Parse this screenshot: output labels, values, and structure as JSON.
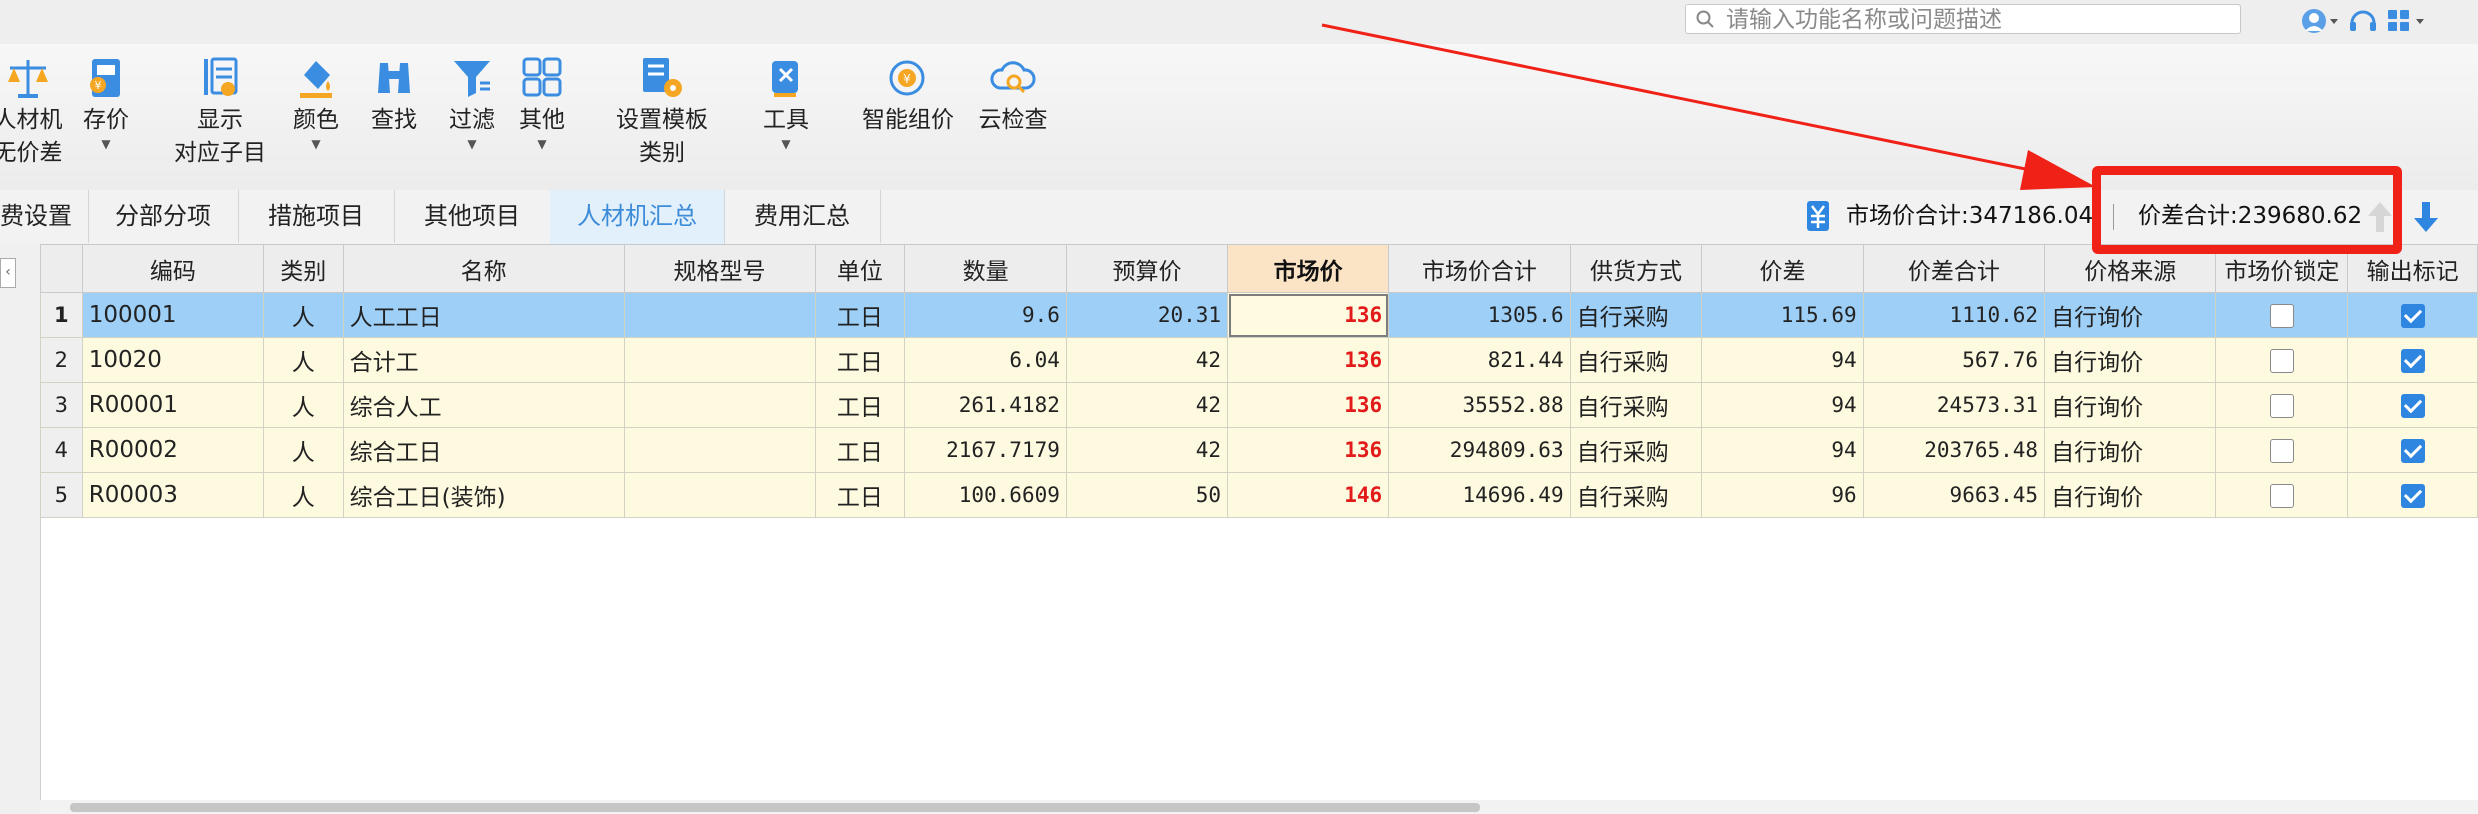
{
  "search": {
    "placeholder": "请输入功能名称或问题描述"
  },
  "ribbon": {
    "items": [
      {
        "label1": "人材机",
        "label2": "无价差",
        "icon": "scale-icon",
        "dropdown": false
      },
      {
        "label1": "存价",
        "label2": "",
        "icon": "save-price-icon",
        "dropdown": true
      },
      {
        "label1": "显示",
        "label2": "对应子目",
        "icon": "show-list-icon",
        "dropdown": false
      },
      {
        "label1": "颜色",
        "label2": "",
        "icon": "paint-bucket-icon",
        "dropdown": true
      },
      {
        "label1": "查找",
        "label2": "",
        "icon": "binoculars-icon",
        "dropdown": false
      },
      {
        "label1": "过滤",
        "label2": "",
        "icon": "filter-icon",
        "dropdown": true
      },
      {
        "label1": "其他",
        "label2": "",
        "icon": "grid-icon",
        "dropdown": true
      },
      {
        "label1": "设置模板",
        "label2": "类别",
        "icon": "template-settings-icon",
        "dropdown": false
      },
      {
        "label1": "工具",
        "label2": "",
        "icon": "tools-icon",
        "dropdown": true
      },
      {
        "label1": "智能组价",
        "label2": "",
        "icon": "smart-pricing-icon",
        "dropdown": false
      },
      {
        "label1": "云检查",
        "label2": "",
        "icon": "cloud-check-icon",
        "dropdown": false
      }
    ]
  },
  "tabs": [
    {
      "label": "费设置",
      "active": false
    },
    {
      "label": "分部分项",
      "active": false
    },
    {
      "label": "措施项目",
      "active": false
    },
    {
      "label": "其他项目",
      "active": false
    },
    {
      "label": "人材机汇总",
      "active": true
    },
    {
      "label": "费用汇总",
      "active": false
    }
  ],
  "summary": {
    "market_total_label": "市场价合计:347186.04",
    "diff_total_label": "价差合计:239680.62"
  },
  "table": {
    "headers": [
      "",
      "编码",
      "类别",
      "名称",
      "规格型号",
      "单位",
      "数量",
      "预算价",
      "市场价",
      "市场价合计",
      "供货方式",
      "价差",
      "价差合计",
      "价格来源",
      "市场价锁定",
      "输出标记"
    ],
    "rows": [
      {
        "no": "1",
        "code": "100001",
        "type": "人",
        "name": "人工工日",
        "spec": "",
        "unit": "工日",
        "qty": "9.6",
        "budget": "20.31",
        "market": "136",
        "market_total": "1305.6",
        "supply": "自行采购",
        "diff": "115.69",
        "diff_total": "1110.62",
        "source": "自行询价",
        "locked": false,
        "output": true
      },
      {
        "no": "2",
        "code": "10020",
        "type": "人",
        "name": "合计工",
        "spec": "",
        "unit": "工日",
        "qty": "6.04",
        "budget": "42",
        "market": "136",
        "market_total": "821.44",
        "supply": "自行采购",
        "diff": "94",
        "diff_total": "567.76",
        "source": "自行询价",
        "locked": false,
        "output": true
      },
      {
        "no": "3",
        "code": "R00001",
        "type": "人",
        "name": "综合人工",
        "spec": "",
        "unit": "工日",
        "qty": "261.4182",
        "budget": "42",
        "market": "136",
        "market_total": "35552.88",
        "supply": "自行采购",
        "diff": "94",
        "diff_total": "24573.31",
        "source": "自行询价",
        "locked": false,
        "output": true
      },
      {
        "no": "4",
        "code": "R00002",
        "type": "人",
        "name": "综合工日",
        "spec": "",
        "unit": "工日",
        "qty": "2167.7179",
        "budget": "42",
        "market": "136",
        "market_total": "294809.63",
        "supply": "自行采购",
        "diff": "94",
        "diff_total": "203765.48",
        "source": "自行询价",
        "locked": false,
        "output": true
      },
      {
        "no": "5",
        "code": "R00003",
        "type": "人",
        "name": "综合工日(装饰)",
        "spec": "",
        "unit": "工日",
        "qty": "100.6609",
        "budget": "50",
        "market": "146",
        "market_total": "14696.49",
        "supply": "自行采购",
        "diff": "96",
        "diff_total": "9663.45",
        "source": "自行询价",
        "locked": false,
        "output": true
      }
    ]
  },
  "colors": {
    "accent": "#2f86e0",
    "highlight_box": "#f02218",
    "market_value": "#e21a1a",
    "selected_row": "#9ecff7",
    "row_bg": "#fdfae0"
  }
}
